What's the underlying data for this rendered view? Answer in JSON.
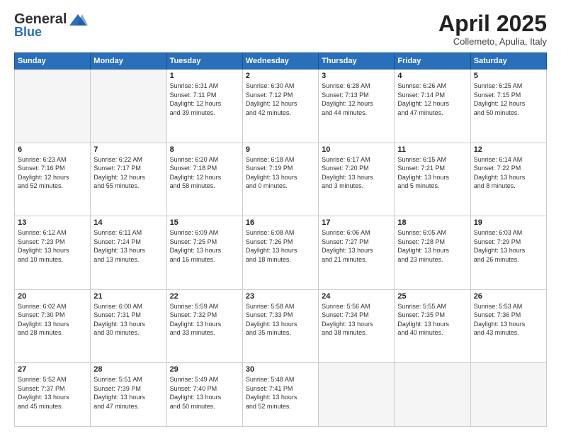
{
  "logo": {
    "general": "General",
    "blue": "Blue"
  },
  "header": {
    "title": "April 2025",
    "subtitle": "Collemeto, Apulia, Italy"
  },
  "days_of_week": [
    "Sunday",
    "Monday",
    "Tuesday",
    "Wednesday",
    "Thursday",
    "Friday",
    "Saturday"
  ],
  "weeks": [
    [
      {
        "day": "",
        "info": ""
      },
      {
        "day": "",
        "info": ""
      },
      {
        "day": "1",
        "info": "Sunrise: 6:31 AM\nSunset: 7:11 PM\nDaylight: 12 hours\nand 39 minutes."
      },
      {
        "day": "2",
        "info": "Sunrise: 6:30 AM\nSunset: 7:12 PM\nDaylight: 12 hours\nand 42 minutes."
      },
      {
        "day": "3",
        "info": "Sunrise: 6:28 AM\nSunset: 7:13 PM\nDaylight: 12 hours\nand 44 minutes."
      },
      {
        "day": "4",
        "info": "Sunrise: 6:26 AM\nSunset: 7:14 PM\nDaylight: 12 hours\nand 47 minutes."
      },
      {
        "day": "5",
        "info": "Sunrise: 6:25 AM\nSunset: 7:15 PM\nDaylight: 12 hours\nand 50 minutes."
      }
    ],
    [
      {
        "day": "6",
        "info": "Sunrise: 6:23 AM\nSunset: 7:16 PM\nDaylight: 12 hours\nand 52 minutes."
      },
      {
        "day": "7",
        "info": "Sunrise: 6:22 AM\nSunset: 7:17 PM\nDaylight: 12 hours\nand 55 minutes."
      },
      {
        "day": "8",
        "info": "Sunrise: 6:20 AM\nSunset: 7:18 PM\nDaylight: 12 hours\nand 58 minutes."
      },
      {
        "day": "9",
        "info": "Sunrise: 6:18 AM\nSunset: 7:19 PM\nDaylight: 13 hours\nand 0 minutes."
      },
      {
        "day": "10",
        "info": "Sunrise: 6:17 AM\nSunset: 7:20 PM\nDaylight: 13 hours\nand 3 minutes."
      },
      {
        "day": "11",
        "info": "Sunrise: 6:15 AM\nSunset: 7:21 PM\nDaylight: 13 hours\nand 5 minutes."
      },
      {
        "day": "12",
        "info": "Sunrise: 6:14 AM\nSunset: 7:22 PM\nDaylight: 13 hours\nand 8 minutes."
      }
    ],
    [
      {
        "day": "13",
        "info": "Sunrise: 6:12 AM\nSunset: 7:23 PM\nDaylight: 13 hours\nand 10 minutes."
      },
      {
        "day": "14",
        "info": "Sunrise: 6:11 AM\nSunset: 7:24 PM\nDaylight: 13 hours\nand 13 minutes."
      },
      {
        "day": "15",
        "info": "Sunrise: 6:09 AM\nSunset: 7:25 PM\nDaylight: 13 hours\nand 16 minutes."
      },
      {
        "day": "16",
        "info": "Sunrise: 6:08 AM\nSunset: 7:26 PM\nDaylight: 13 hours\nand 18 minutes."
      },
      {
        "day": "17",
        "info": "Sunrise: 6:06 AM\nSunset: 7:27 PM\nDaylight: 13 hours\nand 21 minutes."
      },
      {
        "day": "18",
        "info": "Sunrise: 6:05 AM\nSunset: 7:28 PM\nDaylight: 13 hours\nand 23 minutes."
      },
      {
        "day": "19",
        "info": "Sunrise: 6:03 AM\nSunset: 7:29 PM\nDaylight: 13 hours\nand 26 minutes."
      }
    ],
    [
      {
        "day": "20",
        "info": "Sunrise: 6:02 AM\nSunset: 7:30 PM\nDaylight: 13 hours\nand 28 minutes."
      },
      {
        "day": "21",
        "info": "Sunrise: 6:00 AM\nSunset: 7:31 PM\nDaylight: 13 hours\nand 30 minutes."
      },
      {
        "day": "22",
        "info": "Sunrise: 5:59 AM\nSunset: 7:32 PM\nDaylight: 13 hours\nand 33 minutes."
      },
      {
        "day": "23",
        "info": "Sunrise: 5:58 AM\nSunset: 7:33 PM\nDaylight: 13 hours\nand 35 minutes."
      },
      {
        "day": "24",
        "info": "Sunrise: 5:56 AM\nSunset: 7:34 PM\nDaylight: 13 hours\nand 38 minutes."
      },
      {
        "day": "25",
        "info": "Sunrise: 5:55 AM\nSunset: 7:35 PM\nDaylight: 13 hours\nand 40 minutes."
      },
      {
        "day": "26",
        "info": "Sunrise: 5:53 AM\nSunset: 7:36 PM\nDaylight: 13 hours\nand 43 minutes."
      }
    ],
    [
      {
        "day": "27",
        "info": "Sunrise: 5:52 AM\nSunset: 7:37 PM\nDaylight: 13 hours\nand 45 minutes."
      },
      {
        "day": "28",
        "info": "Sunrise: 5:51 AM\nSunset: 7:39 PM\nDaylight: 13 hours\nand 47 minutes."
      },
      {
        "day": "29",
        "info": "Sunrise: 5:49 AM\nSunset: 7:40 PM\nDaylight: 13 hours\nand 50 minutes."
      },
      {
        "day": "30",
        "info": "Sunrise: 5:48 AM\nSunset: 7:41 PM\nDaylight: 13 hours\nand 52 minutes."
      },
      {
        "day": "",
        "info": ""
      },
      {
        "day": "",
        "info": ""
      },
      {
        "day": "",
        "info": ""
      }
    ]
  ]
}
